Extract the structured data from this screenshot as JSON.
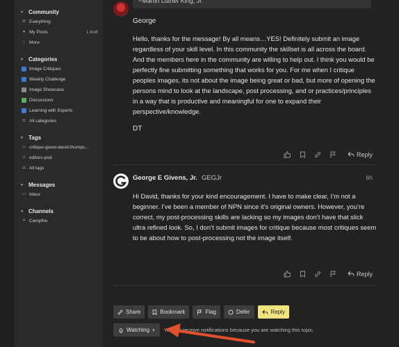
{
  "sidebar": {
    "community": {
      "title": "Community",
      "items": [
        {
          "label": "Everything",
          "icon": "layers-icon"
        },
        {
          "label": "My Posts",
          "icon": "user-icon",
          "count": "1 draft"
        },
        {
          "label": "More",
          "icon": "more-icon"
        }
      ]
    },
    "categories": {
      "title": "Categories",
      "items": [
        {
          "label": "Image Critiques",
          "color": "#3b7bd6"
        },
        {
          "label": "Weekly Challenge",
          "color": "#3b7bd6"
        },
        {
          "label": "Image Showcase",
          "color": "#8a8a8a"
        },
        {
          "label": "Discussions",
          "color": "#59b45c"
        },
        {
          "label": "Learning with Experts",
          "color": "#3b7bd6"
        },
        {
          "label": "All categories",
          "icon": "list-icon"
        }
      ]
    },
    "tags": {
      "title": "Tags",
      "items": [
        {
          "label": "critique-guest-david-thomps..."
        },
        {
          "label": "editors-pick"
        },
        {
          "label": "All tags"
        }
      ]
    },
    "messages": {
      "title": "Messages",
      "items": [
        {
          "label": "Inbox"
        }
      ]
    },
    "channels": {
      "title": "Channels",
      "items": [
        {
          "label": "Campfire"
        }
      ]
    }
  },
  "post1": {
    "quote_text": "~Martin Luther King, Jr.",
    "greeting": "George",
    "body": "Hello, thanks for the message! By all means…YES! Definitely submit an image regardless of your skill level. In this community the skillset is all across the board. And the members here in the community are willing to help out. I think you would be perfectly fine submitting something that works for you. For me when I critique peoples images, its not about the image being great or bad, but more of opening the persons mind to look at the landscape, post processing, and or practices/principles in a way that is productive and meaningful for one to expand their perspective/knowledge.",
    "signature": "DT",
    "reply_label": "Reply"
  },
  "post2": {
    "author_name": "George E Givens, Jr.",
    "username": "GEGJr",
    "age": "8h",
    "body": "Hi David, thanks for your kind encouragement. I have to make clear, I’m not a beginner. I’ve been a member of NPN since it’s original owners. However, you’re correct, my post-processing skills are lacking so my images don’t have that slick ultra refined look. So, I don’t submit images for critique because most critiques seem to be about how to post-processing not the image itself.",
    "reply_label": "Reply"
  },
  "footer": {
    "buttons": [
      {
        "label": "Share",
        "icon": "link-icon"
      },
      {
        "label": "Bookmark",
        "icon": "bookmark-icon"
      },
      {
        "label": "Flag",
        "icon": "flag-icon"
      },
      {
        "label": "Defer",
        "icon": "circle-icon"
      },
      {
        "label": "Reply",
        "icon": "reply-icon"
      }
    ],
    "watching_label": "Watching",
    "notification_text": "You will receive notifications because you are watching this topic."
  },
  "colors": {
    "reply_button": "#f1e37d",
    "arrow": "#e0502f"
  }
}
